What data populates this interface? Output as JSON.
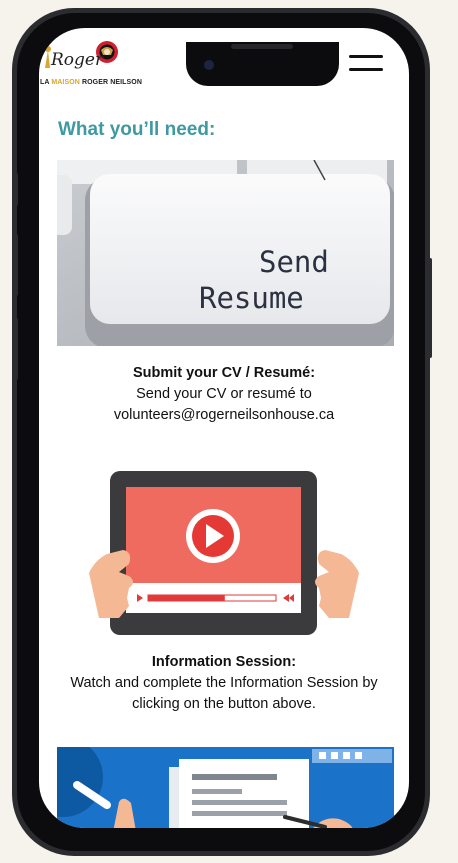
{
  "header": {
    "logo_script": "Roger",
    "logo_prefix": "LA ",
    "logo_highlight": "MAISON",
    "logo_suffix": " ROGER NEILSON"
  },
  "section": {
    "title": "What you’ll need:"
  },
  "steps": [
    {
      "image_label_line1": "Send",
      "image_label_line2": "Resume",
      "title": "Submit your CV / Resumé:",
      "body": "Send your CV or resumé to volunteers@rogerneilsonhouse.ca"
    },
    {
      "title": "Information Session:",
      "body": "Watch and complete the Information Session by clicking on the button above.",
      "video_progress": 0.6
    }
  ],
  "colors": {
    "accent": "#3e9aa1",
    "logo_gold": "#d7a72e",
    "video_red": "#f06b5f",
    "progress_red": "#e03a3a",
    "hand_skin": "#f5b894",
    "doc_blue": "#1a73c9"
  },
  "icons": {
    "menu": "hamburger-icon",
    "play": "play-icon",
    "logo_mark": "senators-logo-icon"
  }
}
